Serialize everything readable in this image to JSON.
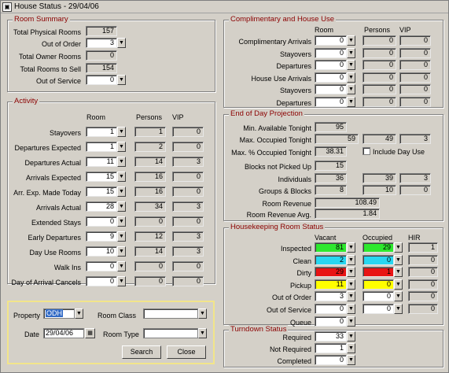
{
  "window": {
    "title": "House Status - 29/04/06",
    "icon": "app-icon"
  },
  "room_summary": {
    "title": "Room Summary",
    "rows": [
      {
        "label": "Total Physical Rooms",
        "value": "157"
      },
      {
        "label": "Out of Order",
        "value": "3"
      },
      {
        "label": "Total Owner Rooms",
        "value": "0"
      },
      {
        "label": "Total Rooms to Sell",
        "value": "154"
      },
      {
        "label": "Out of Service",
        "value": "0"
      }
    ]
  },
  "activity": {
    "title": "Activity",
    "headers": [
      "Room",
      "Persons",
      "VIP"
    ],
    "rows": [
      {
        "label": "Stayovers",
        "room": "1",
        "persons": "1",
        "vip": "0"
      },
      {
        "label": "Departures Expected",
        "room": "1",
        "persons": "2",
        "vip": "0"
      },
      {
        "label": "Departures Actual",
        "room": "11",
        "persons": "14",
        "vip": "3"
      },
      {
        "label": "Arrivals Expected",
        "room": "15",
        "persons": "16",
        "vip": "0"
      },
      {
        "label": "Arr. Exp. Made Today",
        "room": "15",
        "persons": "16",
        "vip": "0"
      },
      {
        "label": "Arrivals Actual",
        "room": "28",
        "persons": "34",
        "vip": "3"
      },
      {
        "label": "Extended Stays",
        "room": "0",
        "persons": "0",
        "vip": "0"
      },
      {
        "label": "Early Departures",
        "room": "9",
        "persons": "12",
        "vip": "3"
      },
      {
        "label": "Day Use Rooms",
        "room": "10",
        "persons": "14",
        "vip": "3"
      },
      {
        "label": "Walk Ins",
        "room": "0",
        "persons": "0",
        "vip": "0"
      },
      {
        "label": "Day of Arrival Cancels",
        "room": "0",
        "persons": "0",
        "vip": "0"
      }
    ]
  },
  "filter": {
    "property_label": "Property",
    "property_value": "ODH",
    "room_class_label": "Room Class",
    "room_class_value": "",
    "date_label": "Date",
    "date_value": "29/04/06",
    "room_type_label": "Room Type",
    "room_type_value": "",
    "search_label": "Search",
    "close_label": "Close"
  },
  "comp": {
    "title": "Complimentary and House Use",
    "headers": [
      "Room",
      "Persons",
      "VIP"
    ],
    "rows": [
      {
        "label": "Complimentary Arrivals",
        "room": "0",
        "persons": "0",
        "vip": "0"
      },
      {
        "label": "Stayovers",
        "room": "0",
        "persons": "0",
        "vip": "0"
      },
      {
        "label": "Departures",
        "room": "0",
        "persons": "0",
        "vip": "0"
      },
      {
        "label": "House Use Arrivals",
        "room": "0",
        "persons": "0",
        "vip": "0"
      },
      {
        "label": "Stayovers",
        "room": "0",
        "persons": "0",
        "vip": "0"
      },
      {
        "label": "Departures",
        "room": "0",
        "persons": "0",
        "vip": "0"
      }
    ]
  },
  "eod": {
    "title": "End of Day Projection",
    "min_available": {
      "label": "Min. Available Tonight",
      "value": "95"
    },
    "max_occupied": {
      "label": "Max. Occupied Tonight",
      "value": "59",
      "v2": "49",
      "v3": "3"
    },
    "max_pct": {
      "label": "Max. % Occupied Tonight",
      "value": "38.31",
      "checkbox_label": "Include Day Use"
    },
    "blocks": {
      "label": "Blocks not Picked Up",
      "value": "15"
    },
    "individuals": {
      "label": "Individuals",
      "value": "36",
      "v2": "39",
      "v3": "3"
    },
    "groups": {
      "label": "Groups & Blocks",
      "value": "8",
      "v2": "10",
      "v3": "0"
    },
    "revenue": {
      "label": "Room Revenue",
      "value": "108.49"
    },
    "revenue_avg": {
      "label": "Room Revenue Avg.",
      "value": "1.84"
    }
  },
  "hk": {
    "title": "Housekeeping Room Status",
    "headers": [
      "Vacant",
      "Occupied",
      "HIR"
    ],
    "rows": [
      {
        "label": "Inspected",
        "vacant": "81",
        "occupied": "29",
        "hir": "1",
        "vcolor": "#2ee82e",
        "ocolor": "#2ee82e"
      },
      {
        "label": "Clean",
        "vacant": "2",
        "occupied": "0",
        "hir": "0",
        "vcolor": "#28d6f0",
        "ocolor": "#28d6f0"
      },
      {
        "label": "Dirty",
        "vacant": "29",
        "occupied": "1",
        "hir": "0",
        "vcolor": "#e81414",
        "ocolor": "#e81414"
      },
      {
        "label": "Pickup",
        "vacant": "11",
        "occupied": "0",
        "hir": "0",
        "vcolor": "#ffff00",
        "ocolor": "#ffff00"
      },
      {
        "label": "Out of Order",
        "vacant": "3",
        "occupied": "0",
        "hir": "0",
        "vcolor": "#ffffff",
        "ocolor": "#ffffff"
      },
      {
        "label": "Out of Service",
        "vacant": "0",
        "occupied": "0",
        "hir": "0",
        "vcolor": "#ffffff",
        "ocolor": "#ffffff"
      },
      {
        "label": "Queue",
        "vacant": "0",
        "occupied": "",
        "hir": "",
        "vcolor": "#ffffff",
        "ocolor": ""
      }
    ]
  },
  "turndown": {
    "title": "Turndown Status",
    "rows": [
      {
        "label": "Required",
        "value": "33"
      },
      {
        "label": "Not Required",
        "value": "1"
      },
      {
        "label": "Completed",
        "value": "0"
      }
    ]
  },
  "icons": {
    "dropdown": "chevron-down-icon",
    "calendar": "calendar-icon"
  }
}
